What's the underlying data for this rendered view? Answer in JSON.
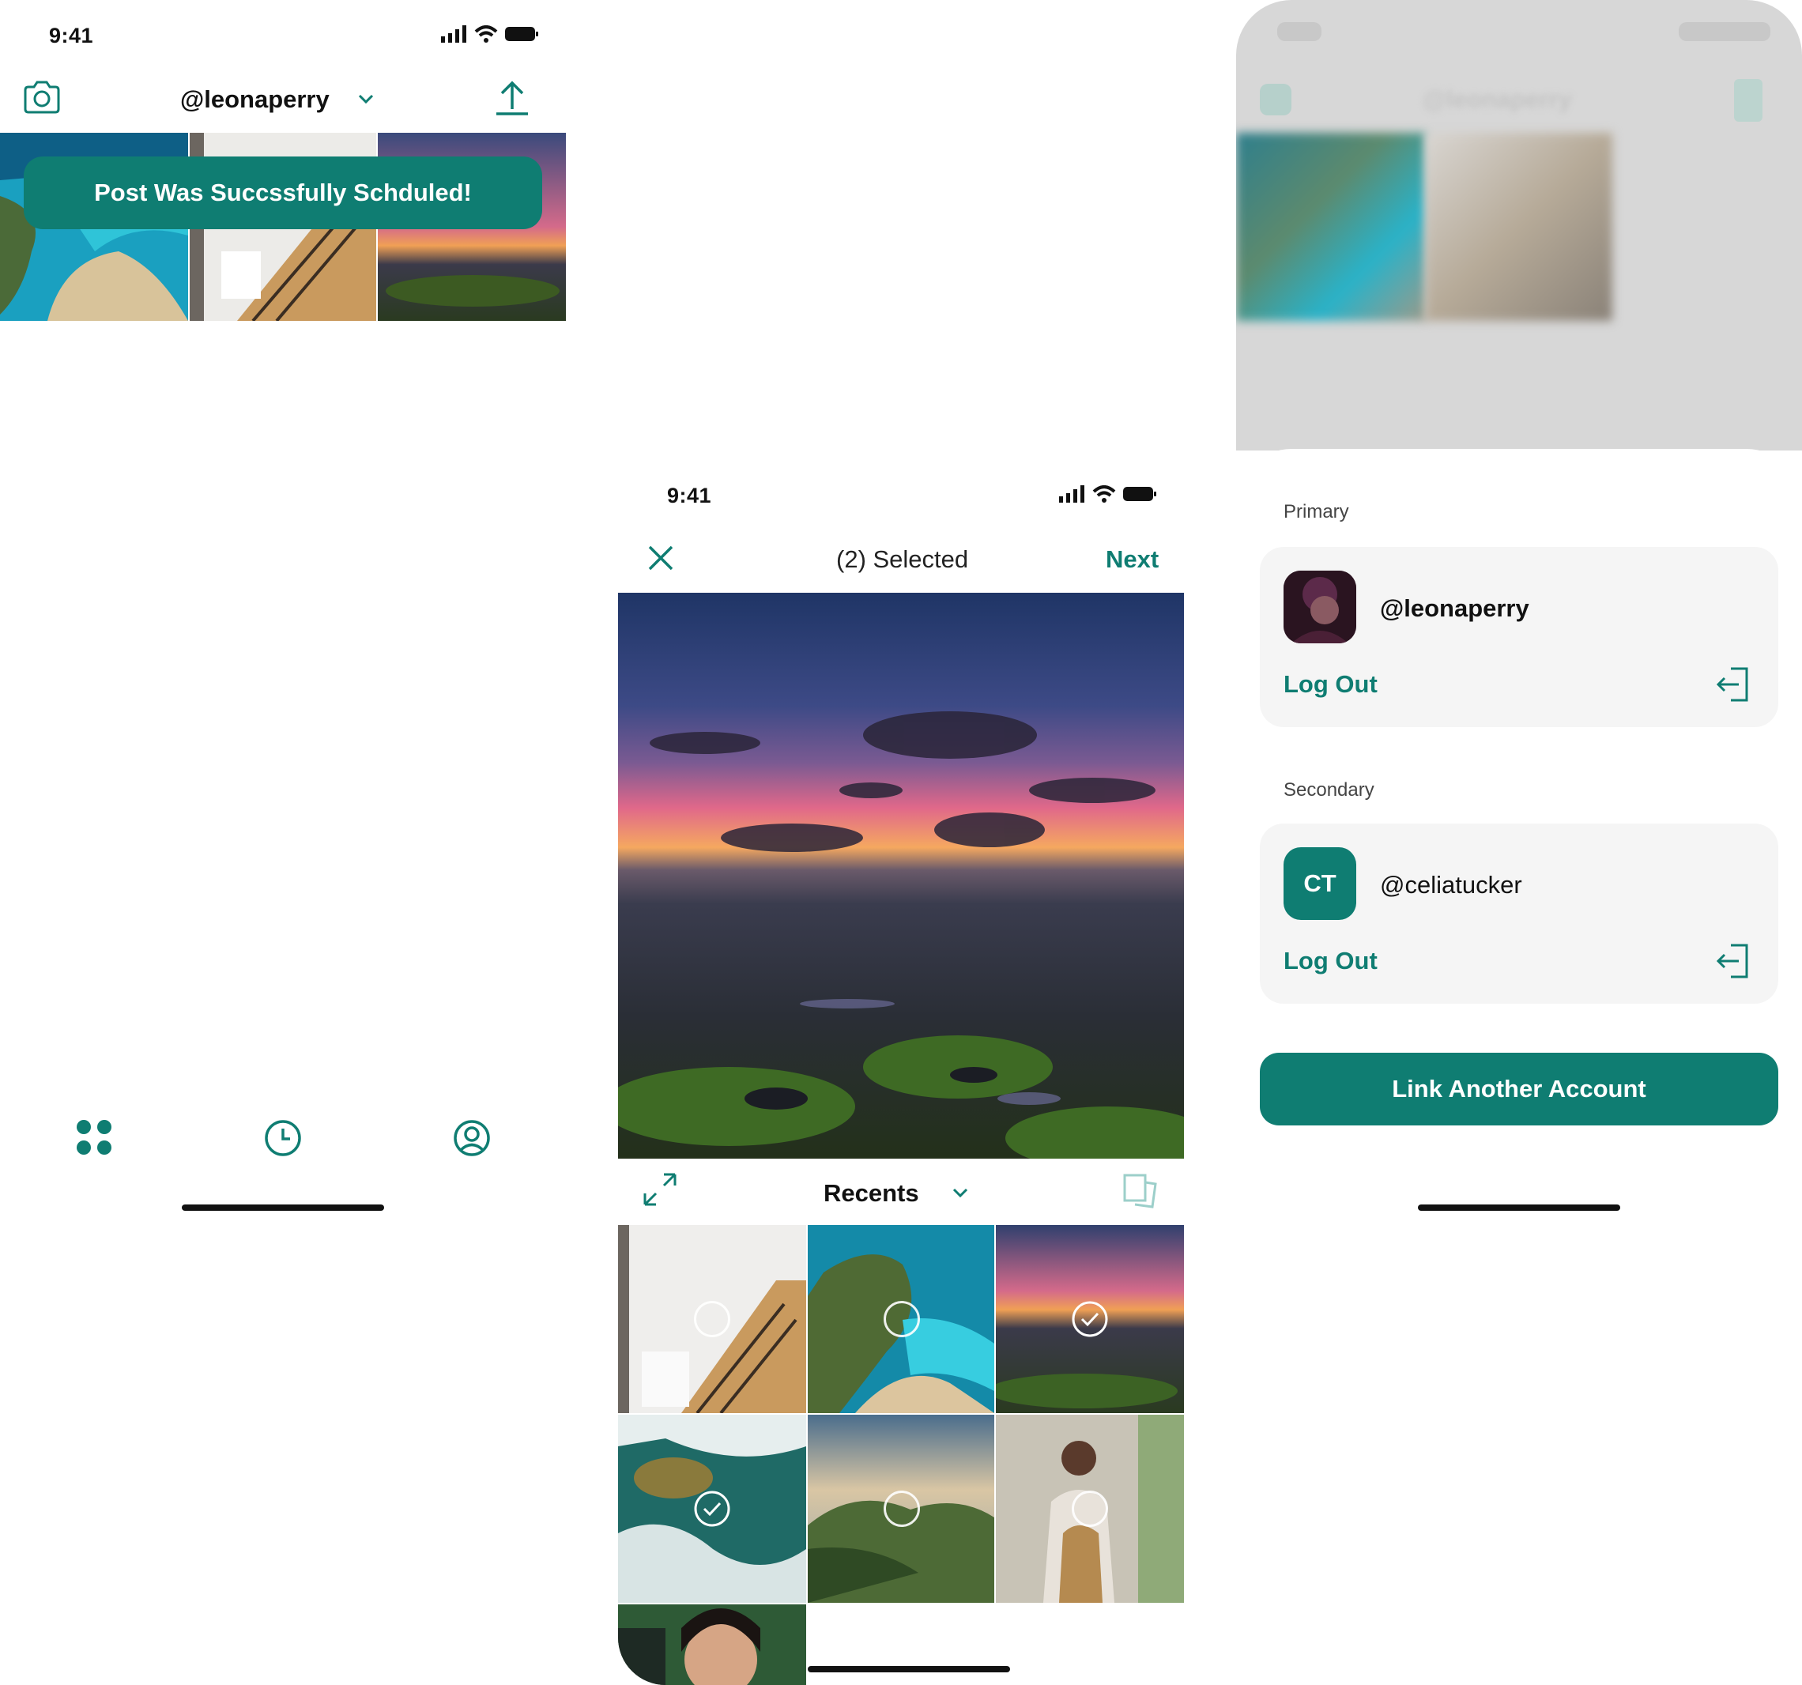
{
  "brand_color": "#0f7d72",
  "status_bar": {
    "time": "9:41"
  },
  "feed_screen": {
    "username": "@leonaperry",
    "toast": "Post Was Succssfully Schduled!",
    "tabs": [
      "grid-icon",
      "clock-icon",
      "profile-icon"
    ]
  },
  "picker_screen": {
    "title": "(2) Selected",
    "next_label": "Next",
    "album": "Recents"
  },
  "accounts_screen": {
    "blurred_username": "@leonaperry",
    "primary_label": "Primary",
    "secondary_label": "Secondary",
    "primary": {
      "handle": "@leonaperry",
      "logout": "Log Out"
    },
    "secondary": {
      "handle": "@celiatucker",
      "initials": "CT",
      "logout": "Log Out"
    },
    "link_button": "Link Another Account"
  }
}
